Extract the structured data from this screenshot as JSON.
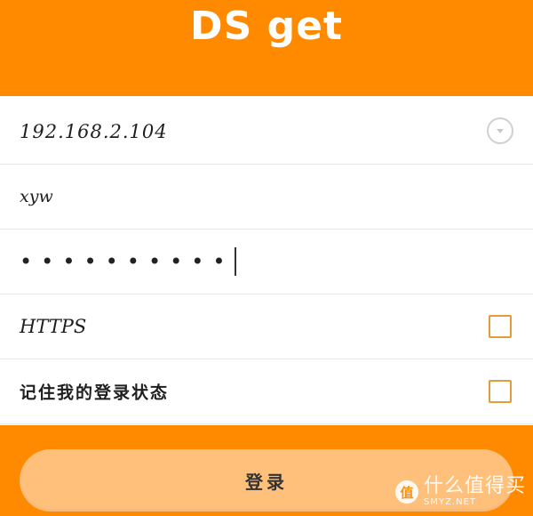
{
  "header": {
    "title": "DS get"
  },
  "form": {
    "host_value": "192.168.2.104",
    "username_value": "xyw",
    "password_mask": "••••••••••",
    "https_label": "HTTPS",
    "remember_label": "记住我的登录状态"
  },
  "login": {
    "label": "登录"
  },
  "watermark": {
    "logo_char": "值",
    "text": "什么值得买",
    "subtext": "SMYZ.NET"
  },
  "colors": {
    "accent": "#ff8a00",
    "button": "#ffc07b",
    "checkbox_border": "#e49b3c"
  },
  "icons": {
    "dropdown": "chevron-down-icon",
    "checkbox": "checkbox-icon"
  }
}
